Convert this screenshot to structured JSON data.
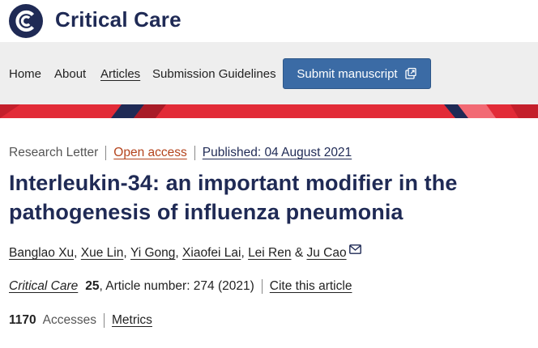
{
  "header": {
    "brand": "Critical Care",
    "logo_icon": "critical-care-logo-icon"
  },
  "nav": {
    "home": "Home",
    "about": "About",
    "articles": "Articles",
    "guidelines": "Submission Guidelines",
    "submit": "Submit manuscript",
    "submit_icon": "external-link-icon"
  },
  "article": {
    "type": "Research Letter",
    "access": "Open access",
    "published": "Published: 04 August 2021",
    "title": "Interleukin-34: an important modifier in the pathogenesis of influenza pneumonia",
    "authors": [
      "Banglao Xu",
      "Xue Lin",
      "Yi Gong",
      "Xiaofei Lai",
      "Lei Ren",
      "Ju Cao"
    ],
    "author_sep": ",",
    "author_amp": "&",
    "mail_icon": "mail-icon",
    "journal": "Critical Care",
    "volume": "25",
    "article_number": ", Article number: 274 (2021)",
    "cite": "Cite this article",
    "accesses_count": "1170",
    "accesses_label": "Accesses",
    "metrics": "Metrics"
  },
  "colors": {
    "brand_navy": "#1f2a55",
    "button_blue": "#3b6ba5",
    "open_access": "#b4441d",
    "banner_red": "#e22b37",
    "banner_dark": "#1f2a55"
  }
}
